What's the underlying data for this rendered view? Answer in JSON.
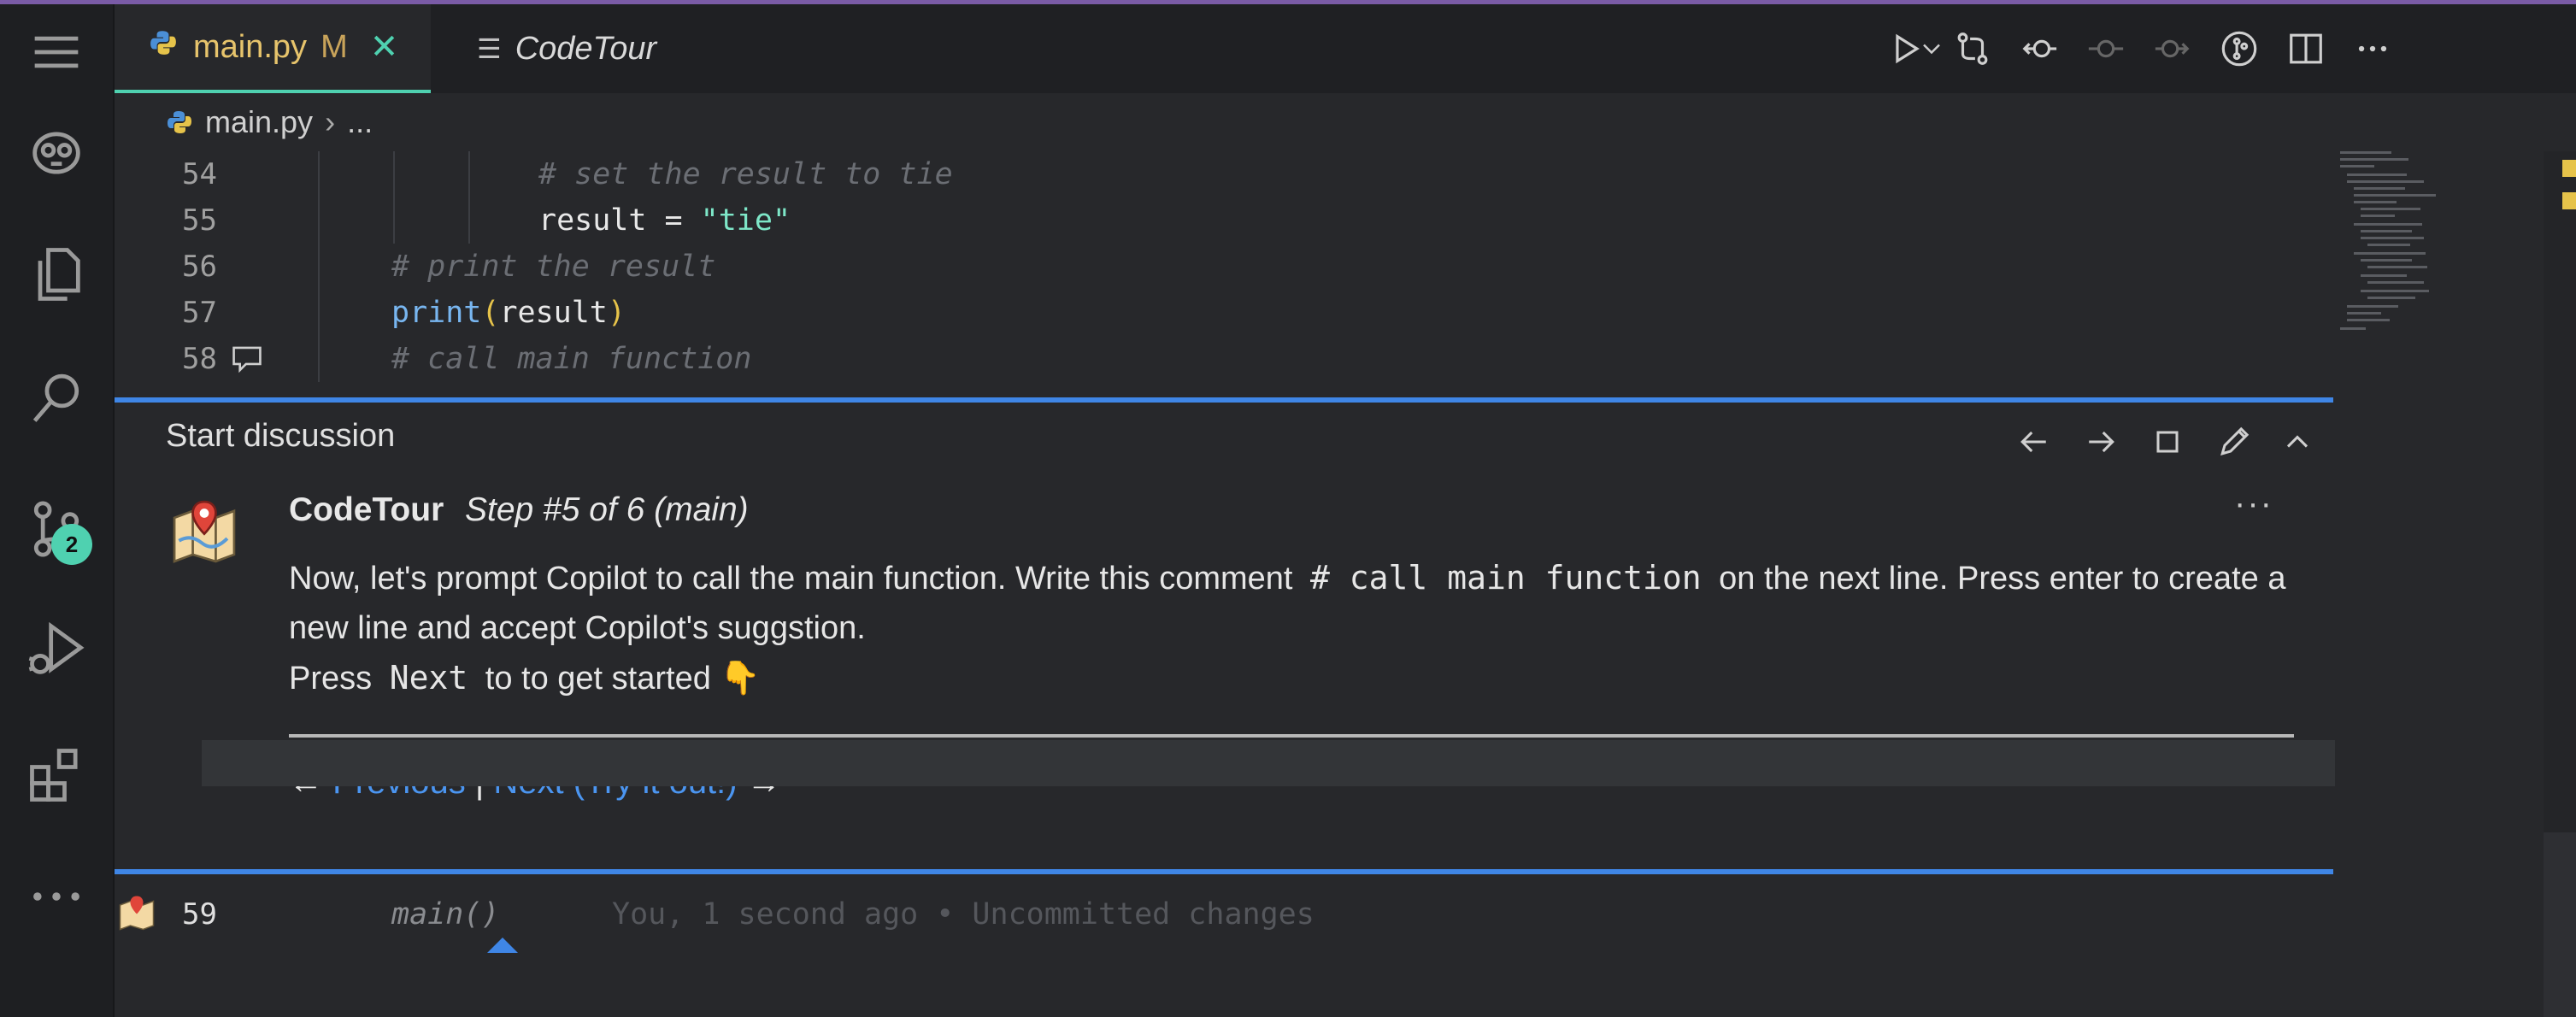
{
  "activity_bar": {
    "items": [
      {
        "name": "menu",
        "icon": "hamburger-icon"
      },
      {
        "name": "copilot",
        "icon": "copilot-icon"
      },
      {
        "name": "explorer",
        "icon": "files-icon"
      },
      {
        "name": "search",
        "icon": "search-icon"
      },
      {
        "name": "source-control",
        "icon": "source-control-icon",
        "badge": "2"
      },
      {
        "name": "run-debug",
        "icon": "debug-icon"
      },
      {
        "name": "extensions",
        "icon": "extensions-icon"
      },
      {
        "name": "more",
        "icon": "ellipsis-icon"
      }
    ]
  },
  "tabs": [
    {
      "label": "main.py",
      "status": "M",
      "active": true,
      "icon": "python-icon"
    },
    {
      "label": "CodeTour",
      "active": false,
      "icon": "lines-icon"
    }
  ],
  "breadcrumb": {
    "file": "main.py",
    "rest": "..."
  },
  "editor": {
    "lines": [
      {
        "number": "54",
        "text": "# set the result to tie"
      },
      {
        "number": "55",
        "text_before": "result = ",
        "string": "\"tie\""
      },
      {
        "number": "56",
        "text": "# print the result"
      },
      {
        "number": "57",
        "fn": "print",
        "open": "(",
        "arg": "result",
        "close": ")"
      },
      {
        "number": "58",
        "text": "# call main function"
      },
      {
        "number": "59",
        "text": "main()",
        "blame": "You, 1 second ago • Uncommitted changes"
      }
    ]
  },
  "discussion": {
    "title": "Start discussion",
    "author": "CodeTour",
    "step": "Step #5 of 6 (main)",
    "more": "···",
    "body_before": "Now, let's prompt Copilot to call the main function. Write this comment",
    "body_code": "# call main function",
    "body_after": "on the next line. Press enter to create a new line and accept Copilot's suggstion.",
    "press_before": "Press",
    "press_code": "Next",
    "press_after": "to to get started 👇",
    "nav": {
      "prev_arrow": "←",
      "prev": "Previous",
      "separator": "|",
      "next": "Next (Try it out!)",
      "next_arrow": "→"
    }
  },
  "colors": {
    "accent": "#3f86e6",
    "tab_accent": "#4fd1b0",
    "modified": "#e7c46c"
  }
}
